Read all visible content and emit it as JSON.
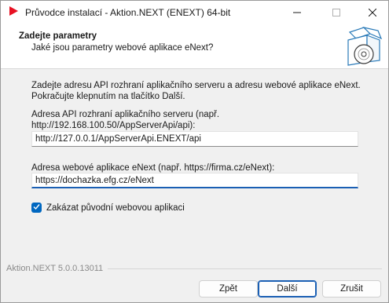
{
  "window": {
    "title": "Průvodce instalací - Aktion.NEXT (ENEXT) 64-bit",
    "app_icon": "red-play-icon",
    "controls": [
      "minimize-icon",
      "maximize-icon",
      "close-icon"
    ]
  },
  "header": {
    "title": "Zadejte parametry",
    "subtitle": "Jaké jsou parametry webové aplikace eNext?",
    "image": "software-box-icon"
  },
  "intro": {
    "line1": "Zadejte adresu API rozhraní aplikačního serveru a adresu webové aplikace eNext.",
    "line2": "Pokračujte klepnutím na tlačítko Další."
  },
  "api_field": {
    "label_line1": "Adresa API rozhraní aplikačního serveru (např.",
    "label_line2": "http://192.168.100.50/AppServerApi/api):",
    "value": "http://127.0.0.1/AppServerApi.ENEXT/api"
  },
  "web_field": {
    "label": "Adresa webové aplikace eNext (např. https://firma.cz/eNext):",
    "value": "https://dochazka.efg.cz/eNext"
  },
  "checkbox": {
    "label": "Zakázat původní webovou aplikaci",
    "checked": true
  },
  "footer": {
    "version": "Aktion.NEXT 5.0.0.13011",
    "back_label": "Zpět",
    "next_label": "Další",
    "cancel_label": "Zrušit"
  },
  "colors": {
    "accent": "#0067c0",
    "app_icon": "#e81123"
  }
}
